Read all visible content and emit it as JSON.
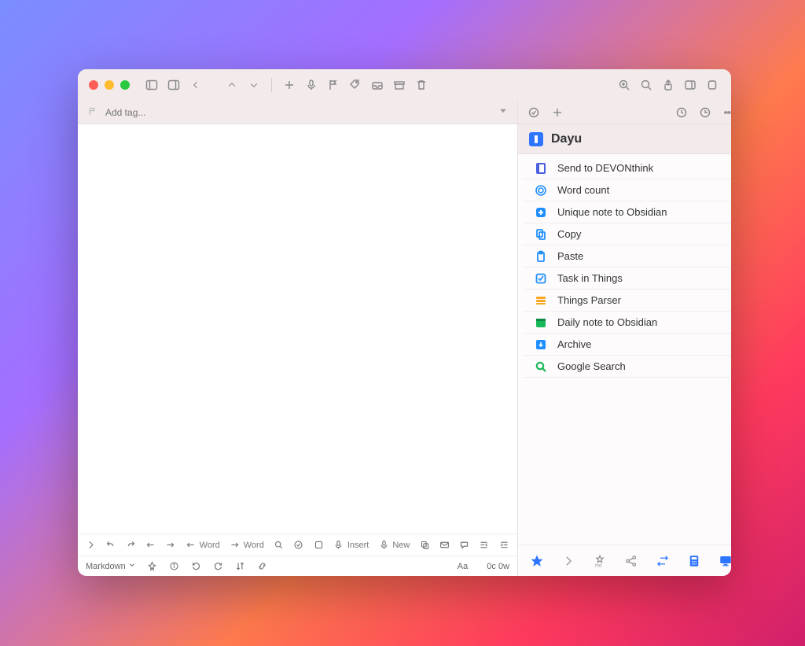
{
  "tagbar": {
    "placeholder": "Add tag..."
  },
  "sidebar": {
    "title": "Dayu"
  },
  "actions": [
    {
      "name": "send-devonthink",
      "label": "Send to DEVONthink"
    },
    {
      "name": "word-count",
      "label": "Word count"
    },
    {
      "name": "unique-note-obsidian",
      "label": "Unique note to Obsidian"
    },
    {
      "name": "copy",
      "label": "Copy"
    },
    {
      "name": "paste",
      "label": "Paste"
    },
    {
      "name": "task-things",
      "label": "Task in Things"
    },
    {
      "name": "things-parser",
      "label": "Things Parser"
    },
    {
      "name": "daily-note-obsidian",
      "label": "Daily note to Obsidian"
    },
    {
      "name": "archive",
      "label": "Archive"
    },
    {
      "name": "google-search",
      "label": "Google Search"
    }
  ],
  "bottombar": {
    "word_left": "Word",
    "word_right": "Word",
    "insert": "Insert",
    "new": "New"
  },
  "statusbar": {
    "mode": "Markdown",
    "font": "Aa",
    "counts": "0c 0w"
  }
}
